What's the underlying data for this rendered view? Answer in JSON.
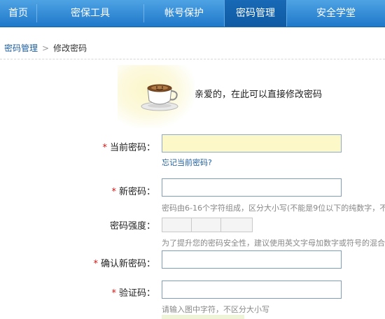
{
  "nav": {
    "items": [
      {
        "label": "首页",
        "active": false
      },
      {
        "label": "密保工具",
        "active": false
      },
      {
        "label": "帐号保护",
        "active": false
      },
      {
        "label": "密码管理",
        "active": true
      },
      {
        "label": "安全学堂",
        "active": false
      }
    ]
  },
  "breadcrumb": {
    "parent": "密码管理",
    "separator": ">",
    "current": "修改密码"
  },
  "welcome": {
    "icon": "coffee-cup-icon",
    "text": "亲爱的，在此可以直接修改密码"
  },
  "form": {
    "required_mark": "*",
    "current_password": {
      "label": "当前密码：",
      "value": "",
      "forgot_link": "忘记当前密码?"
    },
    "new_password": {
      "label": "新密码：",
      "value": "",
      "hint": "密码由6-16个字符组成，区分大小写(不能是9位以下的纯数字，不能"
    },
    "strength": {
      "label": "密码强度：",
      "level": 0,
      "hint": "为了提升您的密码安全性，建议使用英文字母加数字或符号的混合密"
    },
    "confirm_password": {
      "label": "确认新密码：",
      "value": ""
    },
    "captcha": {
      "label": "验证码：",
      "value": "",
      "hint": "请输入图中字符，不区分大小写"
    }
  },
  "colors": {
    "nav_gradient_top": "#4ea3e4",
    "nav_gradient_bottom": "#1f78c9",
    "nav_active": "#1869b6",
    "link": "#1f5fa0",
    "required": "#d61515",
    "focused_field_bg": "#fcf8c8"
  }
}
